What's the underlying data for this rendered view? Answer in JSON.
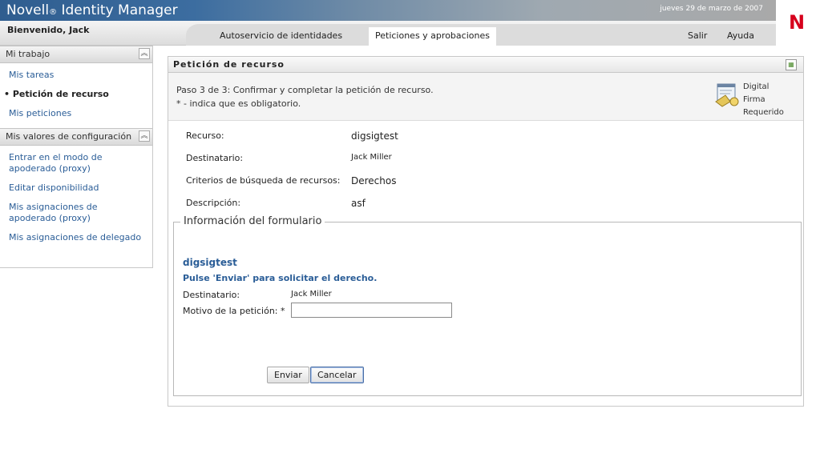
{
  "app": {
    "brand": "Novell",
    "registered": "®",
    "product": "Identity Manager",
    "date": "jueves 29 de marzo de 2007",
    "logo_letter": "N",
    "welcome": "Bienvenido, Jack"
  },
  "nav": {
    "tabs": [
      {
        "label": "Autoservicio de identidades",
        "active": false
      },
      {
        "label": "Peticiones y aprobaciones",
        "active": true
      }
    ],
    "logout": "Salir",
    "help": "Ayuda"
  },
  "sidebar": {
    "sections": [
      {
        "title": "Mi trabajo",
        "items": [
          {
            "label": "Mis tareas",
            "current": false
          },
          {
            "label": "Petición de recurso",
            "current": true
          },
          {
            "label": "Mis peticiones",
            "current": false
          }
        ]
      },
      {
        "title": "Mis valores de configuración",
        "items": [
          {
            "label": "Entrar en el modo de apoderado (proxy)"
          },
          {
            "label": "Editar disponibilidad"
          },
          {
            "label": "Mis asignaciones de apoderado (proxy)"
          },
          {
            "label": "Mis asignaciones de delegado"
          }
        ]
      }
    ]
  },
  "panel": {
    "title": "Petición de recurso",
    "step_line": "Paso 3 de 3: Confirmar y completar la petición de recurso.",
    "required_note": "* - indica que es obligatorio.",
    "signature": [
      "Digital",
      "Firma",
      "Requerido"
    ],
    "fields": [
      {
        "label": "Recurso:",
        "value": "digsigtest"
      },
      {
        "label": "Destinatario:",
        "value": "Jack Miller"
      },
      {
        "label": "Criterios de búsqueda de recursos:",
        "value": "Derechos"
      },
      {
        "label": "Descripción:",
        "value": "asf"
      }
    ],
    "form": {
      "legend": "Información del formulario",
      "resource": "digsigtest",
      "instruction": "Pulse 'Enviar' para solicitar el derecho.",
      "recipient_label": "Destinatario:",
      "recipient_value": "Jack Miller",
      "reason_label": "Motivo de la petición:",
      "reason_required": "*",
      "reason_value": "",
      "submit_label": "Enviar",
      "cancel_label": "Cancelar"
    }
  },
  "colors": {
    "link": "#2a5d97",
    "brand_red": "#d6001c",
    "banner_blue": "#2f5d8f"
  }
}
